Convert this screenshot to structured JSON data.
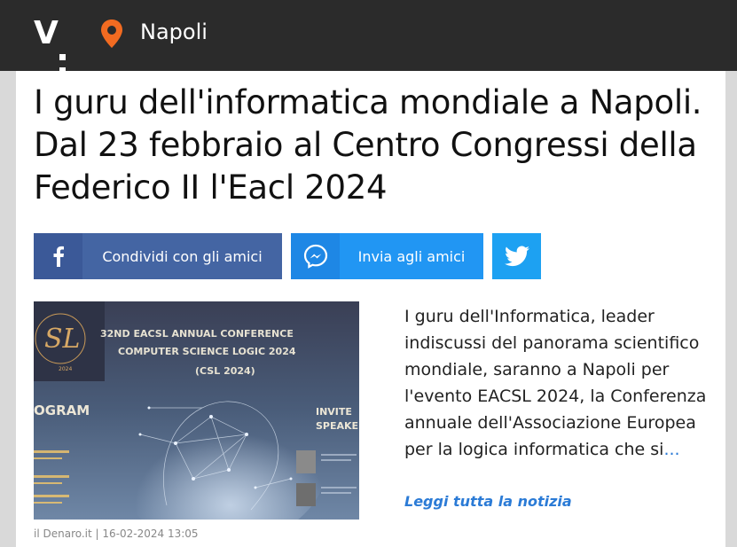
{
  "header": {
    "logo_text": "V",
    "city": "Napoli",
    "pin_color": "#f26b21"
  },
  "article": {
    "title": "I guru dell'informatica mondiale a Napoli. Dal 23 febbraio al Centro Congressi della Federico II l'Eacl 2024",
    "excerpt": "I guru dell'Informatica, leader indiscussi del panorama scientifico mondiale, saranno a Napoli per l'evento EACSL 2024, la Conferenza annuale dell'Associazione Europea per la logica informatica che si",
    "excerpt_ellipsis": "...",
    "read_more": "Leggi tutta la notizia",
    "source": "il Denaro.it",
    "separator": "|",
    "date": "16-02-2024 13:05"
  },
  "share": {
    "facebook_label": "Condividi con gli amici",
    "messenger_label": "Invia agli amici",
    "facebook_icon": "facebook-icon",
    "messenger_icon": "messenger-icon",
    "twitter_icon": "twitter-icon"
  },
  "image": {
    "line1": "32ND EACSL ANNUAL CONFERENCE",
    "line2": "COMPUTER SCIENCE LOGIC 2024",
    "line3": "(CSL 2024)",
    "program": "OGRAM",
    "invited": "INVITE",
    "speakers": "SPEAKE",
    "logo": "SL",
    "logo_year": "2024"
  }
}
